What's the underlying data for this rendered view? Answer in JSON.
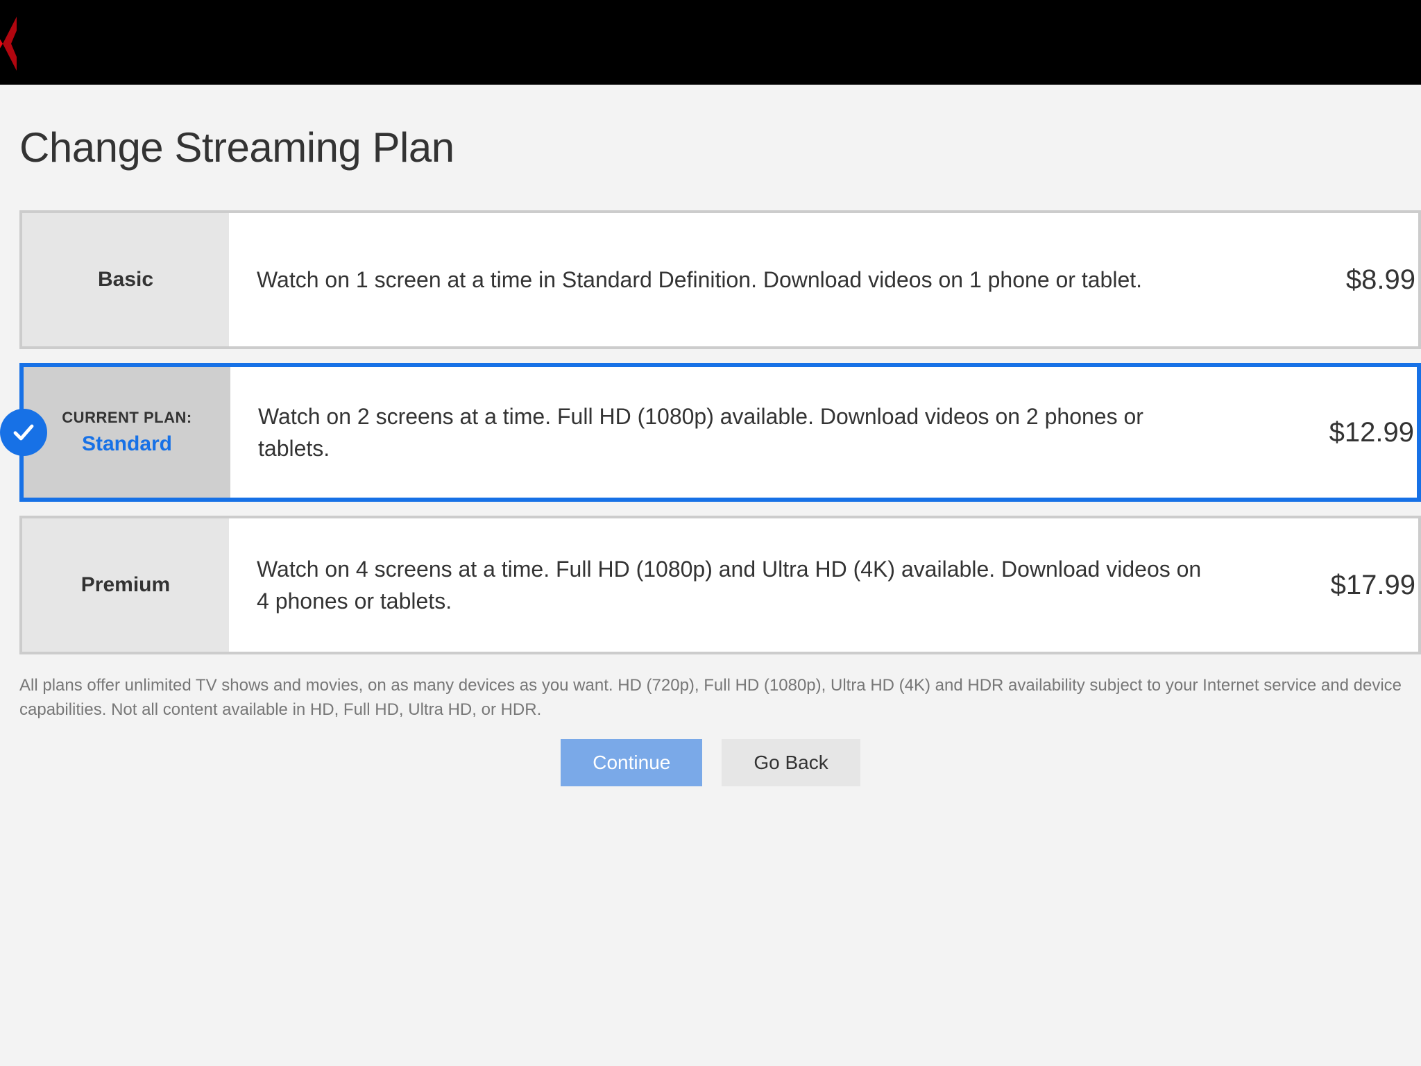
{
  "colors": {
    "accent_blue": "#1771e6",
    "logo_red": "#e50914"
  },
  "page": {
    "title": "Change Streaming Plan"
  },
  "labels": {
    "current_plan": "CURRENT PLAN:"
  },
  "plans": [
    {
      "id": "basic",
      "name": "Basic",
      "description": "Watch on 1 screen at a time in Standard Definition. Download videos on 1 phone or tablet.",
      "price": "$8.99",
      "current": false,
      "selected": false
    },
    {
      "id": "standard",
      "name": "Standard",
      "description": "Watch on 2 screens at a time. Full HD (1080p) available. Download videos on 2 phones or tablets.",
      "price": "$12.99",
      "current": true,
      "selected": true
    },
    {
      "id": "premium",
      "name": "Premium",
      "description": "Watch on 4 screens at a time. Full HD (1080p) and Ultra HD (4K) available. Download videos on 4 phones or tablets.",
      "price": "$17.99",
      "current": false,
      "selected": false
    }
  ],
  "disclaimer": "All plans offer unlimited TV shows and movies, on as many devices as you want. HD (720p), Full HD (1080p), Ultra HD (4K) and HDR availability subject to your Internet service and device capabilities. Not all content available in HD, Full HD, Ultra HD, or HDR.",
  "buttons": {
    "continue": "Continue",
    "go_back": "Go Back"
  }
}
